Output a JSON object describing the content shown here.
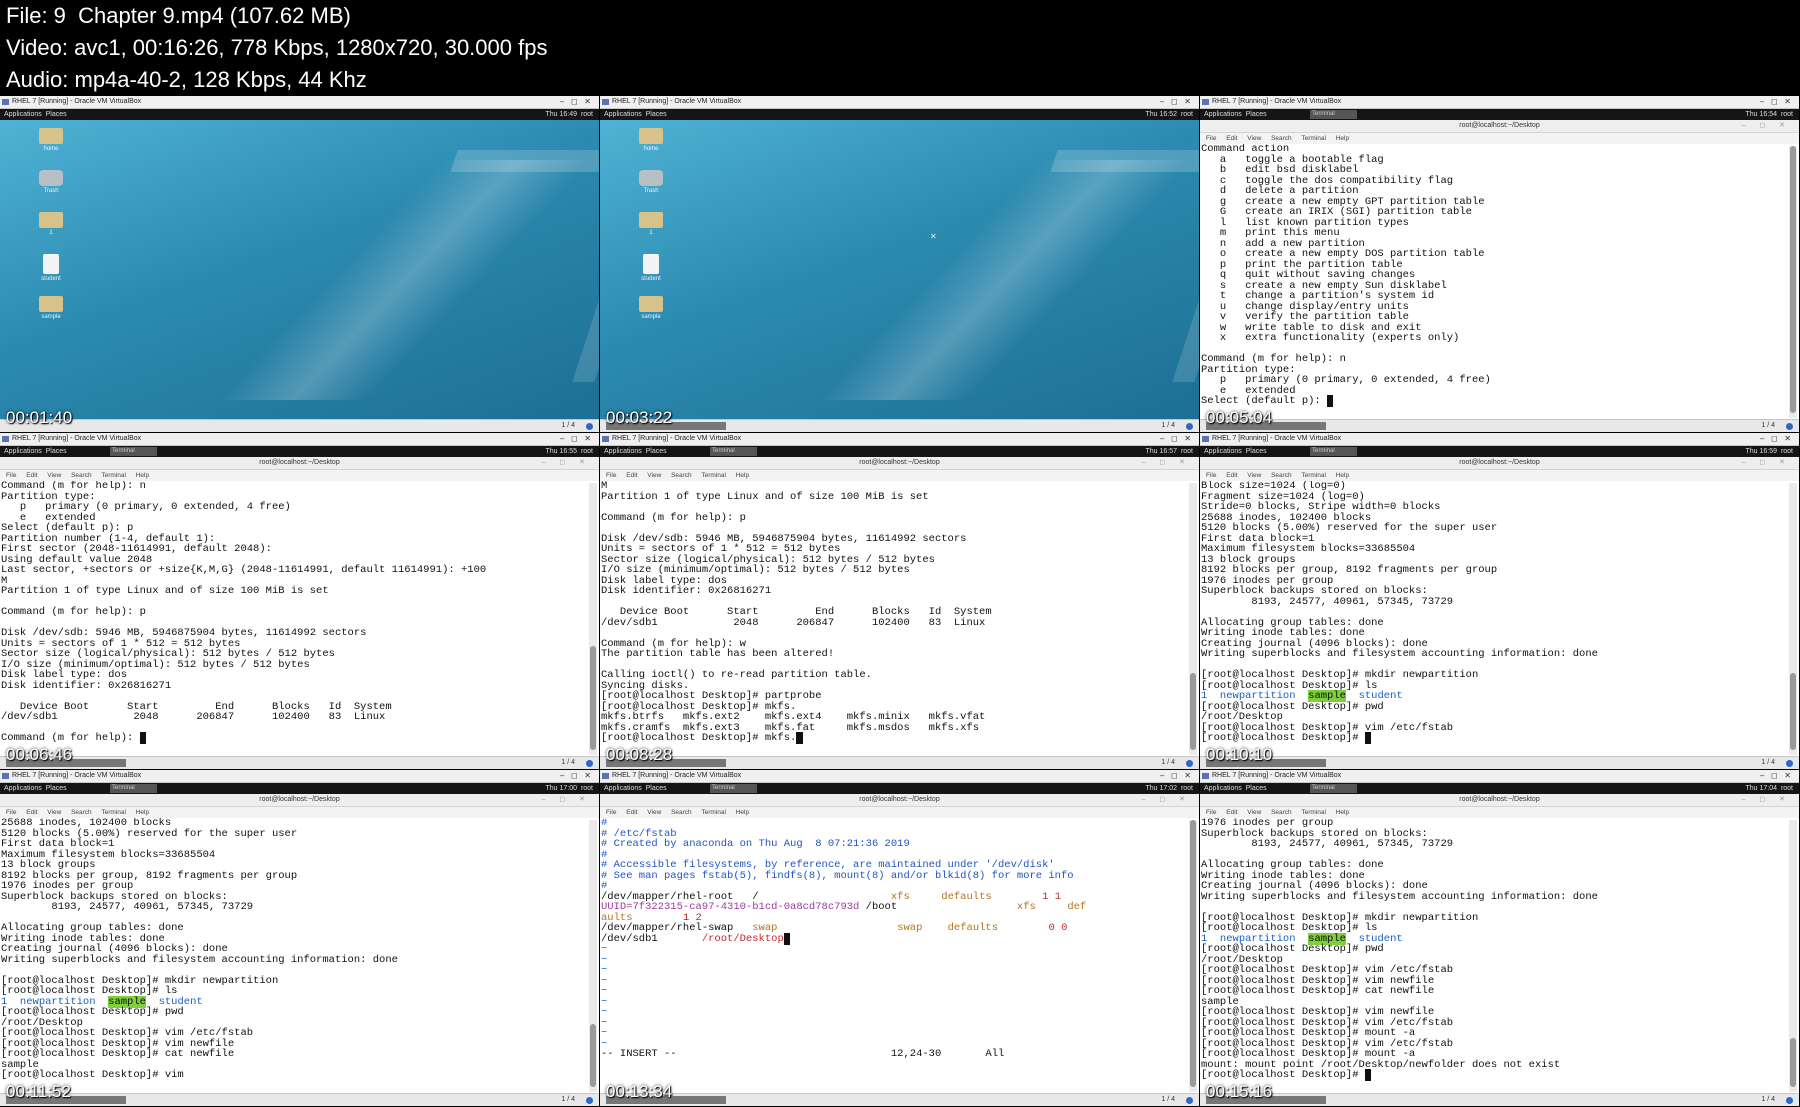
{
  "header": {
    "file": "File: 9  Chapter 9.mp4 (107.62 MB)",
    "video": "Video: avc1, 00:16:26, 778 Kbps, 1280x720, 30.000 fps",
    "audio": "Audio: mp4a-40-2, 128 Kbps, 44 Khz"
  },
  "common": {
    "window_title": "RHEL 7 [Running] - Oracle VM VirtualBox",
    "apps_menu": "Applications",
    "places_menu": "Places",
    "terminal_title": "root@localhost:~/Desktop",
    "menu": "File  Edit  View  Search  Terminal  Help",
    "page_indicator": "1 / 4",
    "user": "root",
    "lang": "en1"
  },
  "frames": [
    {
      "timestamp": "00:01:40",
      "clock": "Thu 16:49",
      "kind": "desktop",
      "icons": [
        "home",
        "Trash",
        "1",
        "student",
        "sample"
      ]
    },
    {
      "timestamp": "00:03:22",
      "clock": "Thu 16:52",
      "kind": "desktop",
      "icons": [
        "home",
        "Trash",
        "1",
        "student",
        "sample"
      ]
    },
    {
      "timestamp": "00:05:04",
      "clock": "Thu 16:54",
      "kind": "terminal",
      "task": "Terminal"
    },
    {
      "timestamp": "00:06:46",
      "clock": "Thu 16:55",
      "kind": "terminal",
      "task": "Terminal"
    },
    {
      "timestamp": "00:08:28",
      "clock": "Thu 16:57",
      "kind": "terminal",
      "task": "Terminal"
    },
    {
      "timestamp": "00:10:10",
      "clock": "Thu 16:59",
      "kind": "terminal",
      "task": "Terminal"
    },
    {
      "timestamp": "00:11:52",
      "clock": "Thu 17:00",
      "kind": "terminal",
      "task": "Terminal"
    },
    {
      "timestamp": "00:13:34",
      "clock": "Thu 17:02",
      "kind": "terminal",
      "task": "Terminal"
    },
    {
      "timestamp": "00:15:16",
      "clock": "Thu 17:04",
      "kind": "terminal",
      "task": "Terminal"
    }
  ],
  "terminals": {
    "f3": "Command action\n   a   toggle a bootable flag\n   b   edit bsd disklabel\n   c   toggle the dos compatibility flag\n   d   delete a partition\n   g   create a new empty GPT partition table\n   G   create an IRIX (SGI) partition table\n   l   list known partition types\n   m   print this menu\n   n   add a new partition\n   o   create a new empty DOS partition table\n   p   print the partition table\n   q   quit without saving changes\n   s   create a new empty Sun disklabel\n   t   change a partition's system id\n   u   change display/entry units\n   v   verify the partition table\n   w   write table to disk and exit\n   x   extra functionality (experts only)\n\nCommand (m for help): n\nPartition type:\n   p   primary (0 primary, 0 extended, 4 free)\n   e   extended\nSelect (default p): ",
    "f4": "Command (m for help): n\nPartition type:\n   p   primary (0 primary, 0 extended, 4 free)\n   e   extended\nSelect (default p): p\nPartition number (1-4, default 1):\nFirst sector (2048-11614991, default 2048):\nUsing default value 2048\nLast sector, +sectors or +size{K,M,G} (2048-11614991, default 11614991): +100\nM\nPartition 1 of type Linux and of size 100 MiB is set\n\nCommand (m for help): p\n\nDisk /dev/sdb: 5946 MB, 5946875904 bytes, 11614992 sectors\nUnits = sectors of 1 * 512 = 512 bytes\nSector size (logical/physical): 512 bytes / 512 bytes\nI/O size (minimum/optimal): 512 bytes / 512 bytes\nDisk label type: dos\nDisk identifier: 0x26816271\n\n   Device Boot      Start         End      Blocks   Id  System\n/dev/sdb1            2048      206847      102400   83  Linux\n\nCommand (m for help): ",
    "f5": "M\nPartition 1 of type Linux and of size 100 MiB is set\n\nCommand (m for help): p\n\nDisk /dev/sdb: 5946 MB, 5946875904 bytes, 11614992 sectors\nUnits = sectors of 1 * 512 = 512 bytes\nSector size (logical/physical): 512 bytes / 512 bytes\nI/O size (minimum/optimal): 512 bytes / 512 bytes\nDisk label type: dos\nDisk identifier: 0x26816271\n\n   Device Boot      Start         End      Blocks   Id  System\n/dev/sdb1            2048      206847      102400   83  Linux\n\nCommand (m for help): w\nThe partition table has been altered!\n\nCalling ioctl() to re-read partition table.\nSyncing disks.\n[root@localhost Desktop]# partprobe\n[root@localhost Desktop]# mkfs.\nmkfs.btrfs   mkfs.ext2    mkfs.ext4    mkfs.minix   mkfs.vfat\nmkfs.cramfs  mkfs.ext3    mkfs.fat     mkfs.msdos   mkfs.xfs\n[root@localhost Desktop]# mkfs.",
    "f6_pre": "Block size=1024 (log=0)\nFragment size=1024 (log=0)\nStride=0 blocks, Stripe width=0 blocks\n25688 inodes, 102400 blocks\n5120 blocks (5.00%) reserved for the super user\nFirst data block=1\nMaximum filesystem blocks=33685504\n13 block groups\n8192 blocks per group, 8192 fragments per group\n1976 inodes per group\nSuperblock backups stored on blocks:\n        8193, 24577, 40961, 57345, 73729\n\nAllocating group tables: done\nWriting inode tables: done\nCreating journal (4096 blocks): done\nWriting superblocks and filesystem accounting information: done\n\n[root@localhost Desktop]# mkdir newpartition\n[root@localhost Desktop]# ls\n",
    "f6_post": "[root@localhost Desktop]# pwd\n/root/Desktop\n[root@localhost Desktop]# vim /etc/fstab\n[root@localhost Desktop]# ",
    "f7_pre": "25688 inodes, 102400 blocks\n5120 blocks (5.00%) reserved for the super user\nFirst data block=1\nMaximum filesystem blocks=33685504\n13 block groups\n8192 blocks per group, 8192 fragments per group\n1976 inodes per group\nSuperblock backups stored on blocks:\n        8193, 24577, 40961, 57345, 73729\n\nAllocating group tables: done\nWriting inode tables: done\nCreating journal (4096 blocks): done\nWriting superblocks and filesystem accounting information: done\n\n[root@localhost Desktop]# mkdir newpartition\n[root@localhost Desktop]# ls\n",
    "f7_post": "[root@localhost Desktop]# pwd\n/root/Desktop\n[root@localhost Desktop]# vim /etc/fstab\n[root@localhost Desktop]# vim newfile\n[root@localhost Desktop]# cat newfile\nsample\n[root@localhost Desktop]# vim",
    "f9_pre": "1976 inodes per group\nSuperblock backups stored on blocks:\n        8193, 24577, 40961, 57345, 73729\n\nAllocating group tables: done\nWriting inode tables: done\nCreating journal (4096 blocks): done\nWriting superblocks and filesystem accounting information: done\n\n[root@localhost Desktop]# mkdir newpartition\n[root@localhost Desktop]# ls\n",
    "f9_post": "[root@localhost Desktop]# pwd\n/root/Desktop\n[root@localhost Desktop]# vim /etc/fstab\n[root@localhost Desktop]# vim newfile\n[root@localhost Desktop]# cat newfile\nsample\n[root@localhost Desktop]# vim newfile\n[root@localhost Desktop]# vim /etc/fstab\n[root@localhost Desktop]# mount -a\n[root@localhost Desktop]# vim /etc/fstab\n[root@localhost Desktop]# mount -a\nmount: mount point /root/Desktop/newfolder does not exist\n[root@localhost Desktop]# ",
    "ls": {
      "one": "1",
      "dir": "newpartition",
      "sample": "sample",
      "student": "student"
    },
    "fstab": {
      "c1": "#",
      "c2": "# /etc/fstab",
      "c3": "# Created by anaconda on Thu Aug  8 07:21:36 2019",
      "c4": "#",
      "c5": "# Accessible filesystems, by reference, are maintained under '/dev/disk'",
      "c6": "# See man pages fstab(5), findfs(8), mount(8) and/or blkid(8) for more info",
      "c7": "#",
      "r1_dev": "/dev/mapper/rhel-root   /",
      "r1_fs": "xfs",
      "r1_opt": "defaults",
      "r1_n": "1 1",
      "r2_uuid": "UUID=7f322315-ca97-4310-b1cd-0a8cd78c793d",
      "r2_mnt": "/boot",
      "r2_fs": "xfs",
      "r2_opt": "def",
      "r2_wrap": "aults",
      "r2_n": "1 2",
      "r3_dev": "/dev/mapper/rhel-swap",
      "r3_type": "swap",
      "r3_fs": "swap",
      "r3_opt": "defaults",
      "r3_n": "0 0",
      "r4_dev": "/dev/sdb1",
      "r4_mnt": "/root/Desktop",
      "tilde": "~\n~\n~\n~\n~\n~\n~\n~\n~\n~",
      "mode": "-- INSERT --",
      "pos": "12,24-30",
      "all": "All"
    }
  }
}
